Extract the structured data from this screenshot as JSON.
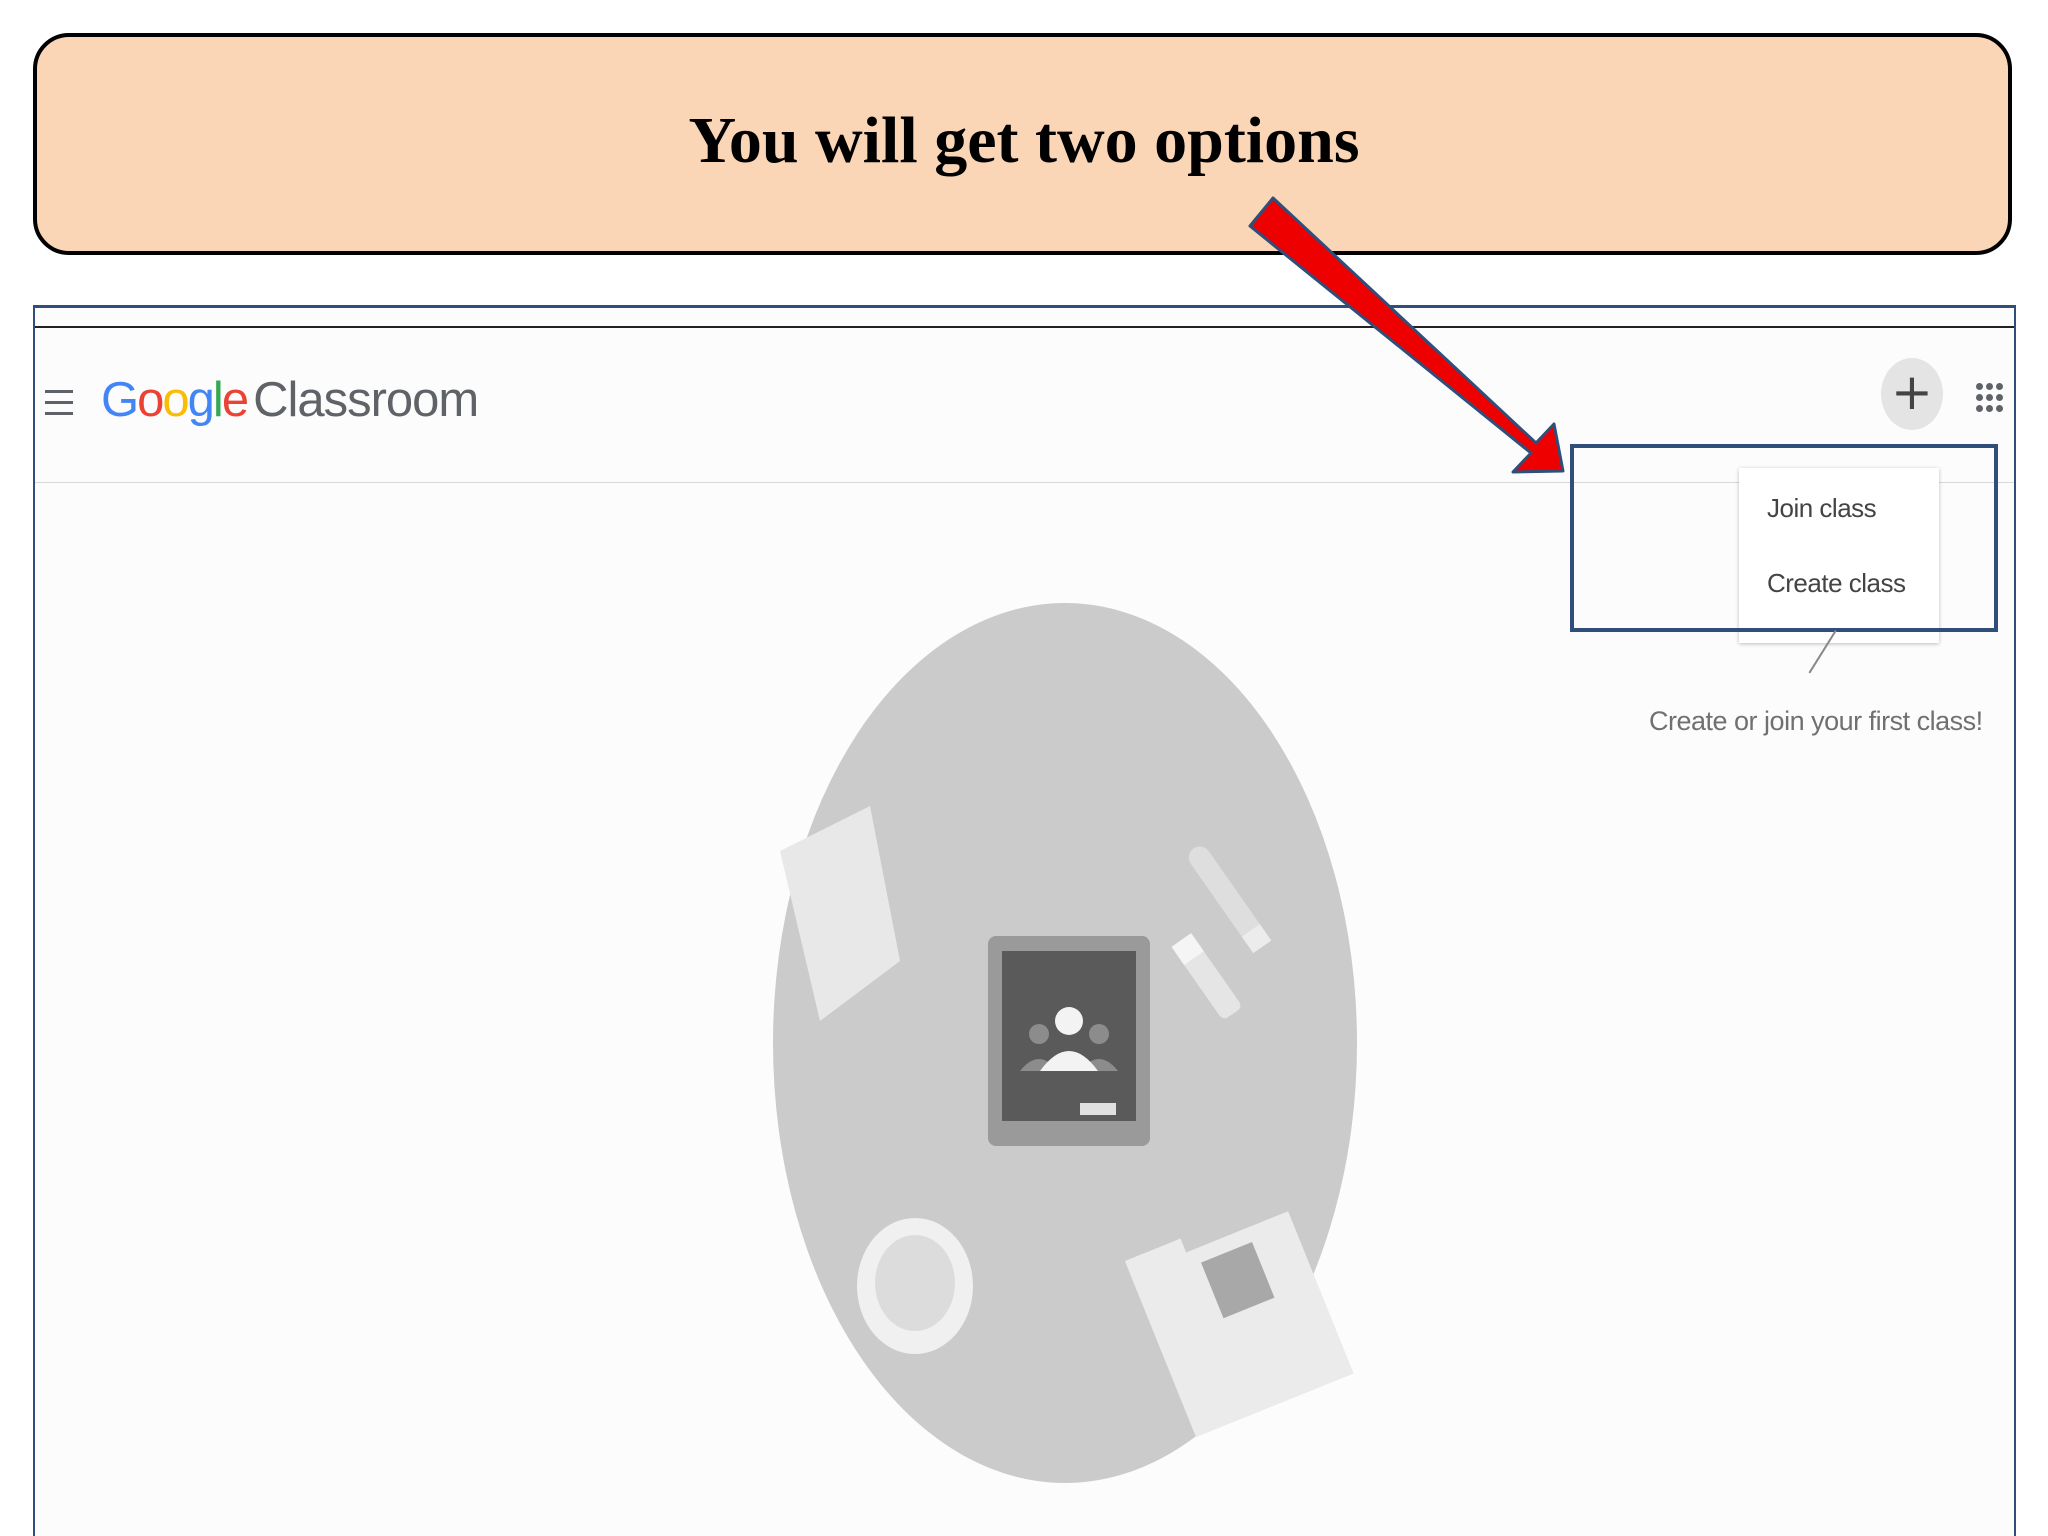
{
  "banner": {
    "title": "You will get two options"
  },
  "app": {
    "logo_letters": [
      "G",
      "o",
      "o",
      "g",
      "l",
      "e"
    ],
    "product_name": "Classroom",
    "header_buttons": {
      "add": "+"
    },
    "menu": {
      "items": [
        {
          "label": "Join class"
        },
        {
          "label": "Create class"
        }
      ]
    },
    "empty_state_hint": "Create or join your first class!"
  },
  "colors": {
    "banner_fill": "#fad5b6",
    "arrow_fill": "#ee0000",
    "highlight_border": "#2f4f7a",
    "google_blue": "#4285f4",
    "google_red": "#ea4335",
    "google_yellow": "#fbbc05",
    "google_green": "#34a853"
  },
  "icons": {
    "menu": "hamburger-icon",
    "add": "plus-icon",
    "apps": "apps-grid-icon",
    "illustration": "classroom-illustration"
  }
}
